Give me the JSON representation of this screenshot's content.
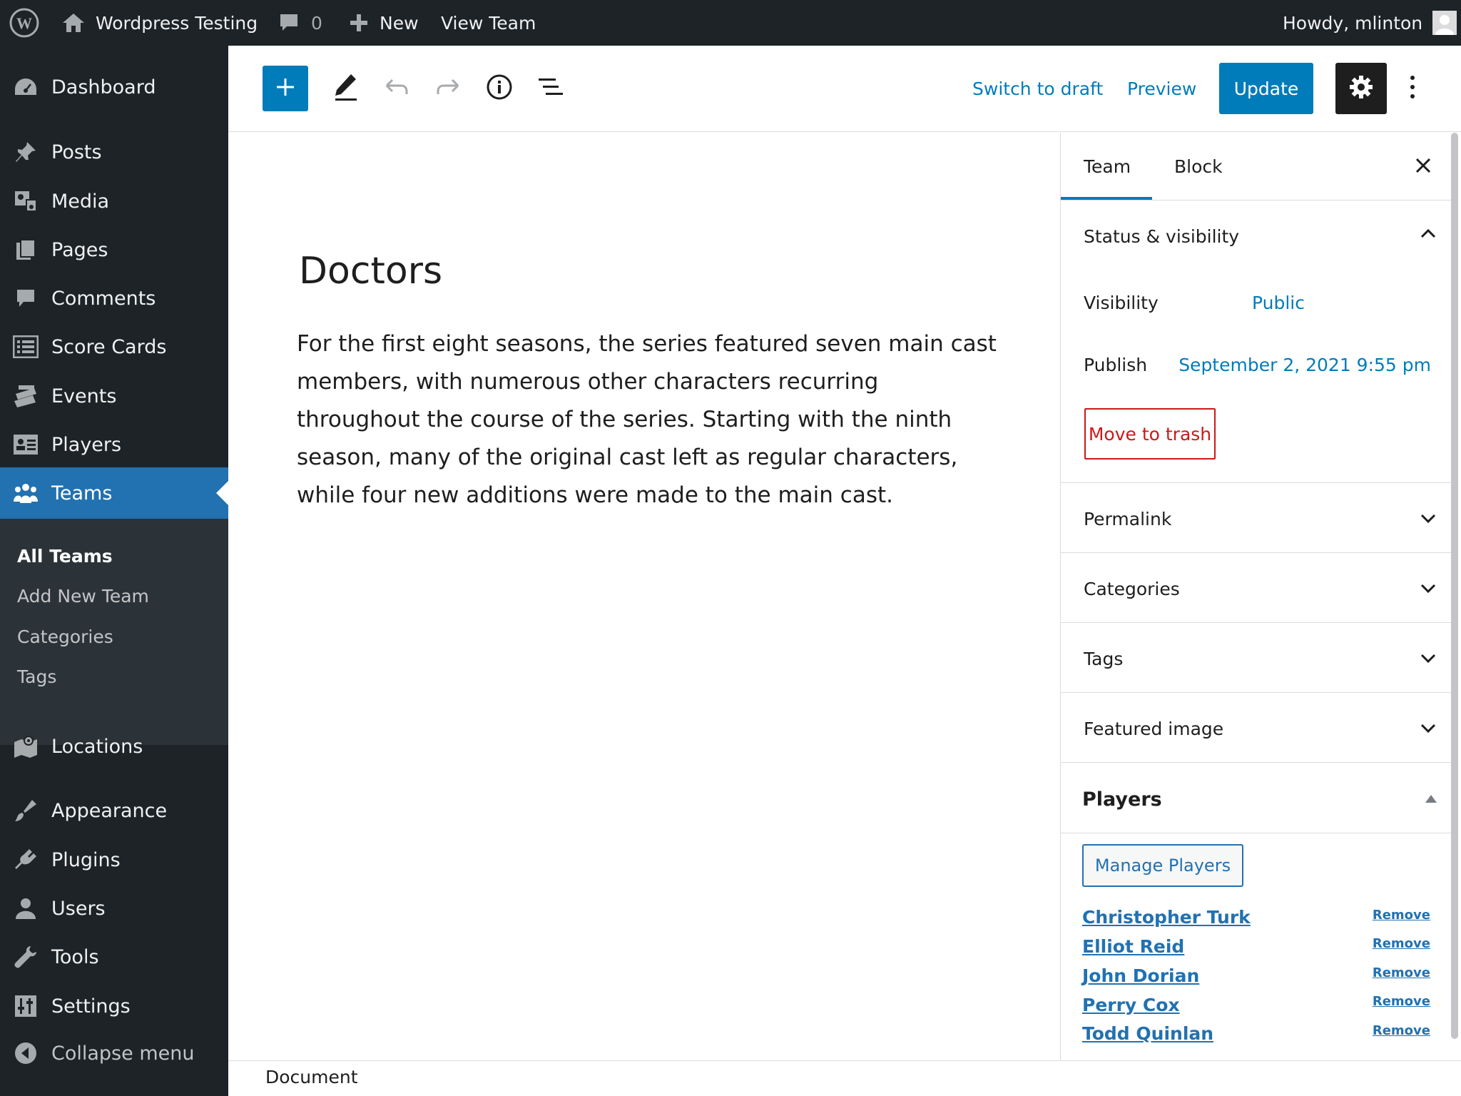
{
  "adminbar": {
    "site_name": "Wordpress Testing",
    "comments_count": "0",
    "new_label": "New",
    "view_label": "View Team",
    "howdy": "Howdy, mlinton"
  },
  "sidebar": {
    "items": [
      {
        "label": "Dashboard",
        "icon": "dashboard-icon"
      },
      {
        "label": "Posts",
        "icon": "pin-icon"
      },
      {
        "label": "Media",
        "icon": "media-icon"
      },
      {
        "label": "Pages",
        "icon": "pages-icon"
      },
      {
        "label": "Comments",
        "icon": "comment-icon"
      },
      {
        "label": "Score Cards",
        "icon": "list-icon"
      },
      {
        "label": "Events",
        "icon": "events-icon"
      },
      {
        "label": "Players",
        "icon": "id-card-icon"
      },
      {
        "label": "Teams",
        "icon": "groups-icon"
      },
      {
        "label": "Locations",
        "icon": "map-icon"
      },
      {
        "label": "Appearance",
        "icon": "brush-icon"
      },
      {
        "label": "Plugins",
        "icon": "plug-icon"
      },
      {
        "label": "Users",
        "icon": "user-icon"
      },
      {
        "label": "Tools",
        "icon": "wrench-icon"
      },
      {
        "label": "Settings",
        "icon": "sliders-icon"
      },
      {
        "label": "Collapse menu",
        "icon": "collapse-icon"
      }
    ],
    "submenu": [
      "All Teams",
      "Add New Team",
      "Categories",
      "Tags"
    ]
  },
  "toolbar": {
    "switch_draft": "Switch to draft",
    "preview": "Preview",
    "update": "Update"
  },
  "post": {
    "title": "Doctors",
    "body": "For the first eight seasons, the series featured seven main cast members, with numerous other characters recurring throughout the course  of the series. Starting with the ninth season, many of the original cast  left as regular characters, while four new additions were made to the  main cast."
  },
  "settings": {
    "tabs": [
      "Team",
      "Block"
    ],
    "status_title": "Status & visibility",
    "visibility_label": "Visibility",
    "visibility_value": "Public",
    "publish_label": "Publish",
    "publish_value": "September 2, 2021 9:55 pm",
    "trash": "Move to trash",
    "panels": [
      "Permalink",
      "Categories",
      "Tags",
      "Featured image"
    ],
    "players_title": "Players",
    "manage_players": "Manage Players",
    "players": [
      {
        "name": "Christopher Turk",
        "remove": "Remove"
      },
      {
        "name": "Elliot Reid",
        "remove": "Remove"
      },
      {
        "name": "John Dorian",
        "remove": "Remove"
      },
      {
        "name": "Perry Cox",
        "remove": "Remove"
      },
      {
        "name": "Todd Quinlan",
        "remove": "Remove"
      }
    ]
  },
  "footer": {
    "breadcrumb": "Document"
  }
}
